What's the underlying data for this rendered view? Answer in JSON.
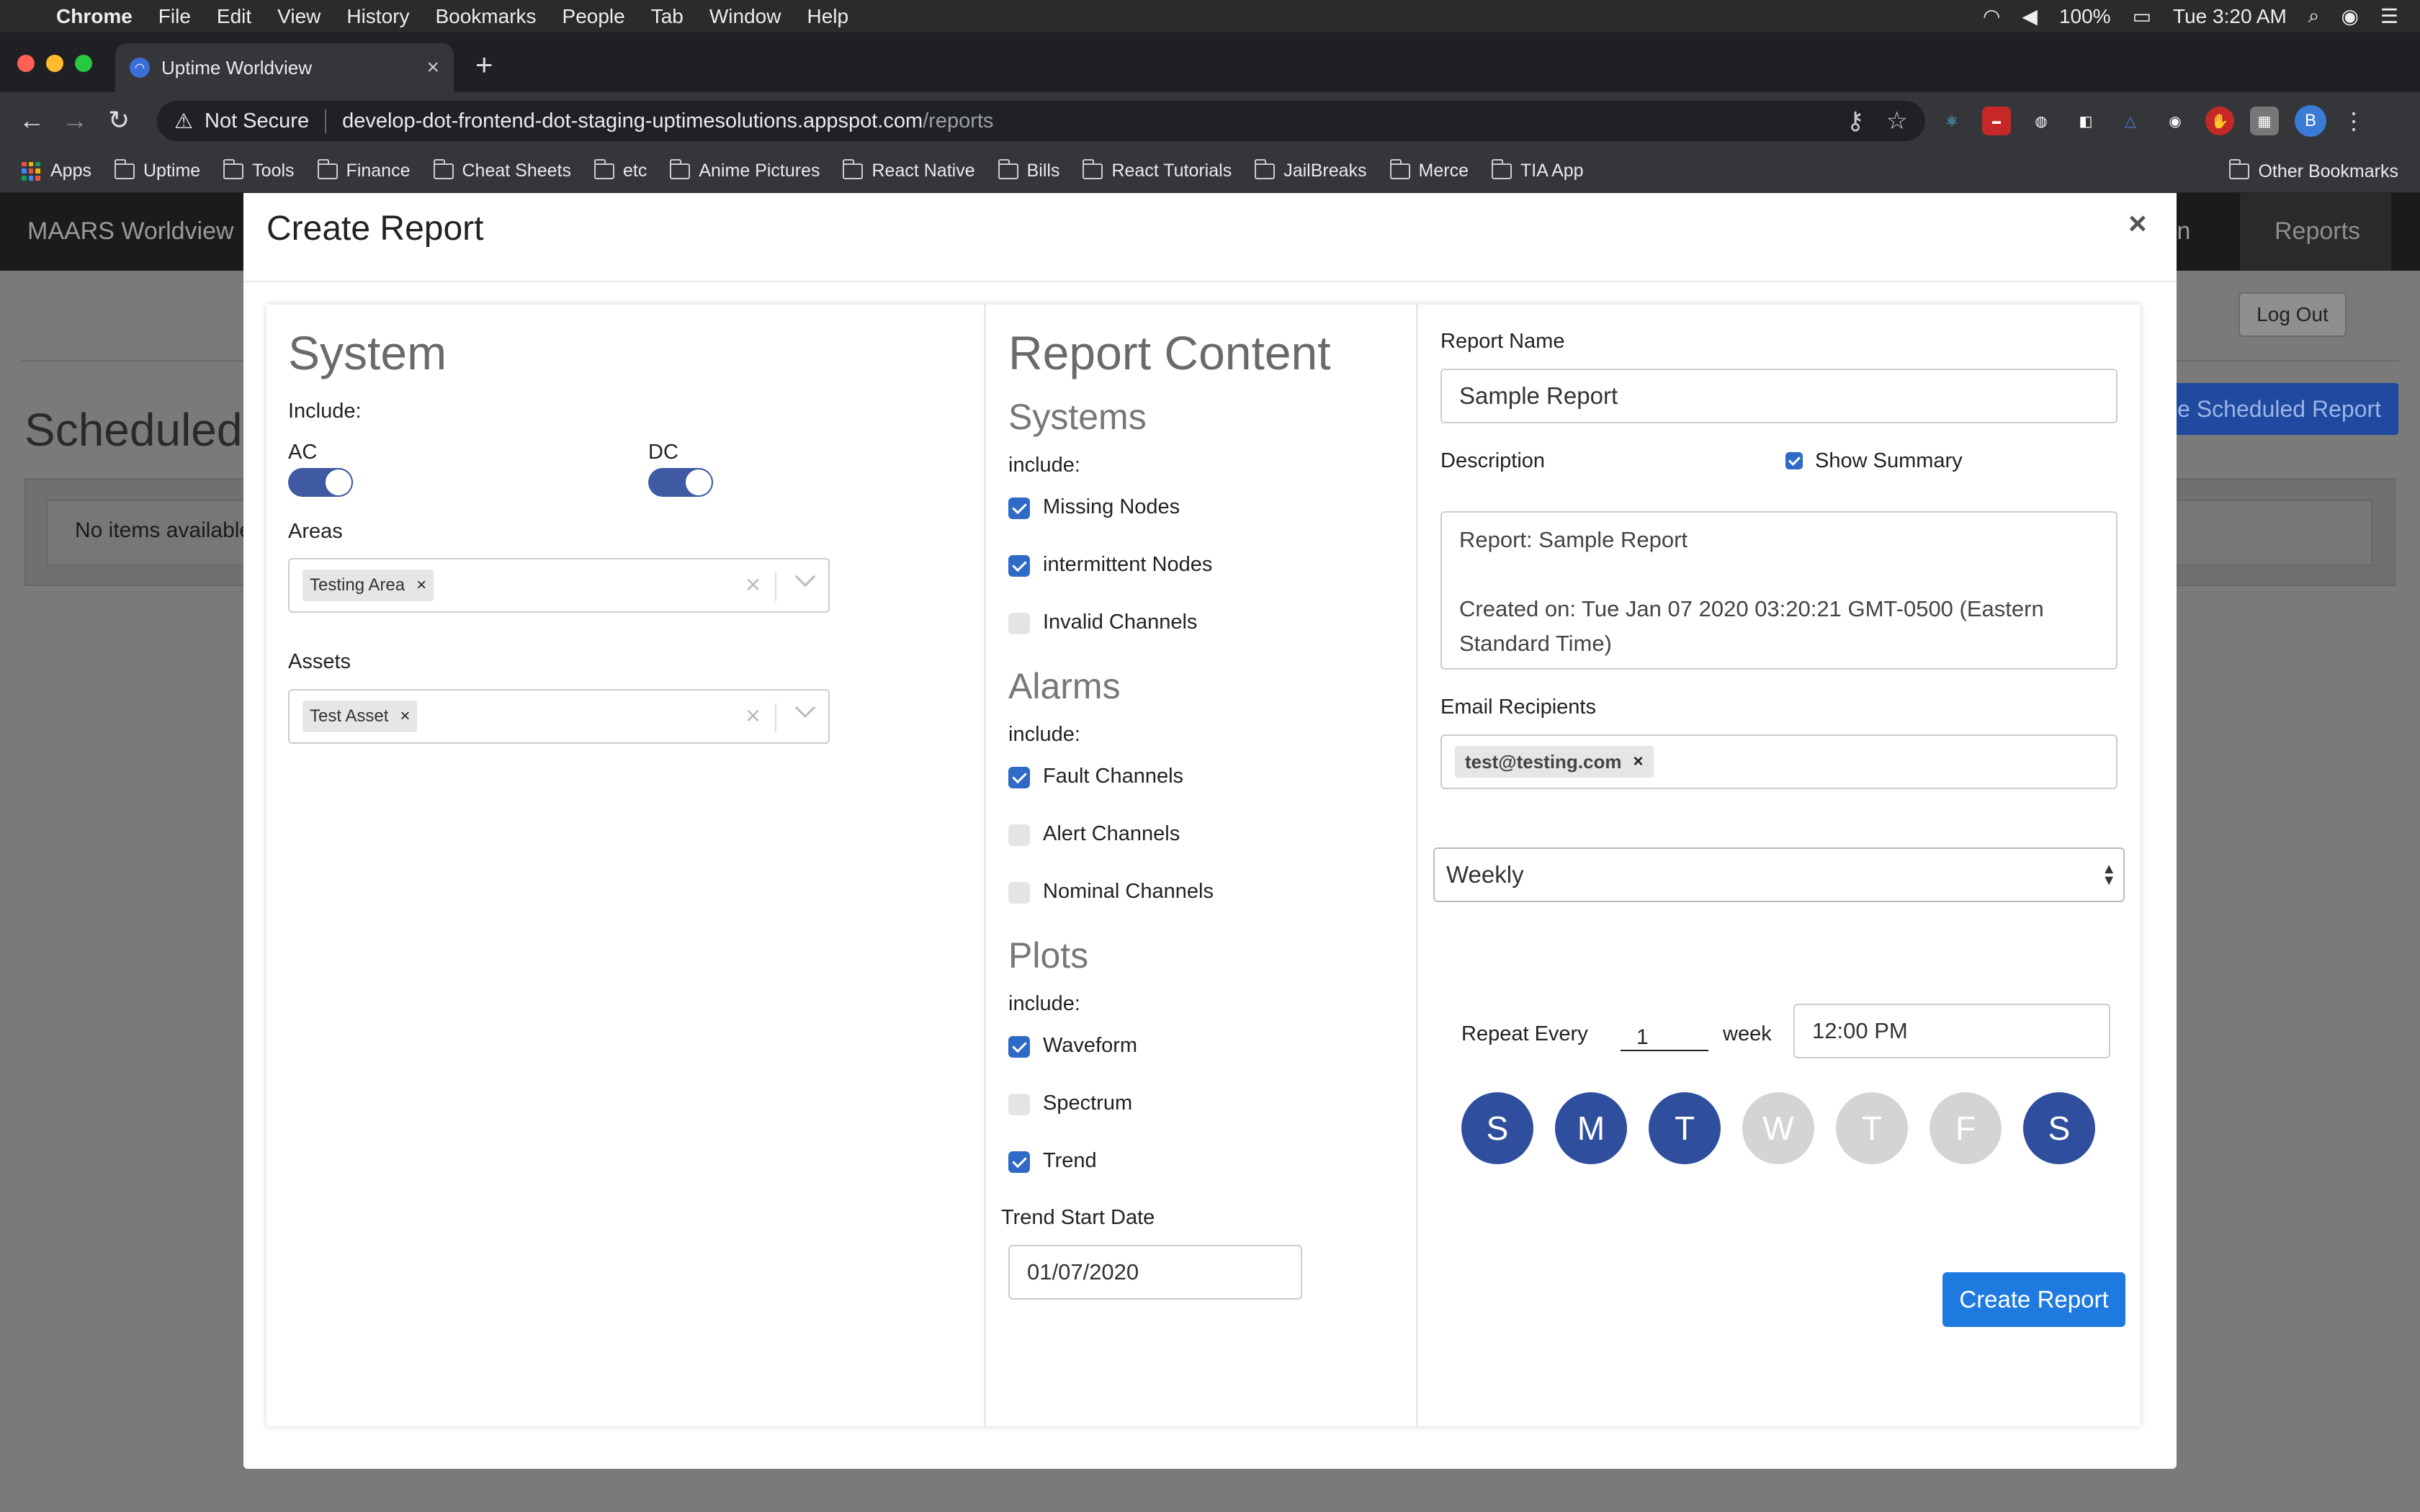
{
  "menubar": {
    "app": "Chrome",
    "items": [
      "File",
      "Edit",
      "View",
      "History",
      "Bookmarks",
      "People",
      "Tab",
      "Window",
      "Help"
    ],
    "battery": "100%",
    "clock": "Tue 3:20 AM"
  },
  "browser": {
    "tab_title": "Uptime Worldview",
    "security": "Not Secure",
    "url_host": "develop-dot-frontend-dot-staging-uptimesolutions.appspot.com",
    "url_path": "/reports",
    "profile_initial": "B"
  },
  "bookmarks": {
    "apps": "Apps",
    "folders": [
      "Uptime",
      "Tools",
      "Finance",
      "Cheat Sheets",
      "etc",
      "Anime Pictures",
      "React Native",
      "Bills",
      "React Tutorials",
      "JailBreaks",
      "Merce",
      "TIA App"
    ],
    "other": "Other Bookmarks"
  },
  "app": {
    "brand": "MAARS Worldview",
    "nav_partial": "in",
    "nav_reports": "Reports",
    "logout": "Log Out",
    "scheduled_title": "Scheduled",
    "scheduled_button": "e Scheduled Report",
    "no_items": "No items available"
  },
  "modal": {
    "title": "Create Report",
    "close": "×",
    "system": {
      "heading": "System",
      "include_label": "Include:",
      "ac_label": "AC",
      "dc_label": "DC",
      "areas_label": "Areas",
      "areas_chip": "Testing Area",
      "assets_label": "Assets",
      "assets_chip": "Test Asset",
      "chip_remove": "×",
      "clear": "×"
    },
    "content": {
      "heading": "Report Content",
      "include": "include:",
      "systems_heading": "Systems",
      "systems": [
        {
          "label": "Missing Nodes",
          "checked": true
        },
        {
          "label": "intermittent Nodes",
          "checked": true
        },
        {
          "label": "Invalid Channels",
          "checked": false
        }
      ],
      "alarms_heading": "Alarms",
      "alarms": [
        {
          "label": "Fault Channels",
          "checked": true
        },
        {
          "label": "Alert Channels",
          "checked": false
        },
        {
          "label": "Nominal Channels",
          "checked": false
        }
      ],
      "plots_heading": "Plots",
      "plots": [
        {
          "label": "Waveform",
          "checked": true
        },
        {
          "label": "Spectrum",
          "checked": false
        },
        {
          "label": "Trend",
          "checked": true
        }
      ],
      "trend_start_label": "Trend Start Date",
      "trend_start_value": "01/07/2020"
    },
    "details": {
      "report_name_label": "Report Name",
      "report_name_value": "Sample Report",
      "description_label": "Description",
      "show_summary_label": "Show Summary",
      "description_line1": "Report: Sample Report",
      "description_line2": "Created on: Tue Jan 07 2020 03:20:21 GMT-0500 (Eastern",
      "description_line3": "Standard Time)",
      "email_label": "Email Recipients",
      "email_chip": "test@testing.com",
      "frequency": "Weekly",
      "repeat_label": "Repeat Every",
      "repeat_value": "1",
      "repeat_unit": "week",
      "time_value": "12:00  PM",
      "days": [
        {
          "label": "S",
          "selected": true
        },
        {
          "label": "M",
          "selected": true
        },
        {
          "label": "T",
          "selected": true
        },
        {
          "label": "W",
          "selected": false
        },
        {
          "label": "T",
          "selected": false
        },
        {
          "label": "F",
          "selected": false
        },
        {
          "label": "S",
          "selected": true
        }
      ],
      "create_button": "Create Report"
    }
  },
  "colors": {
    "accent": "#2f4f9e",
    "button_blue": "#1f7ae0",
    "checkbox_blue": "#2f6ac6"
  }
}
